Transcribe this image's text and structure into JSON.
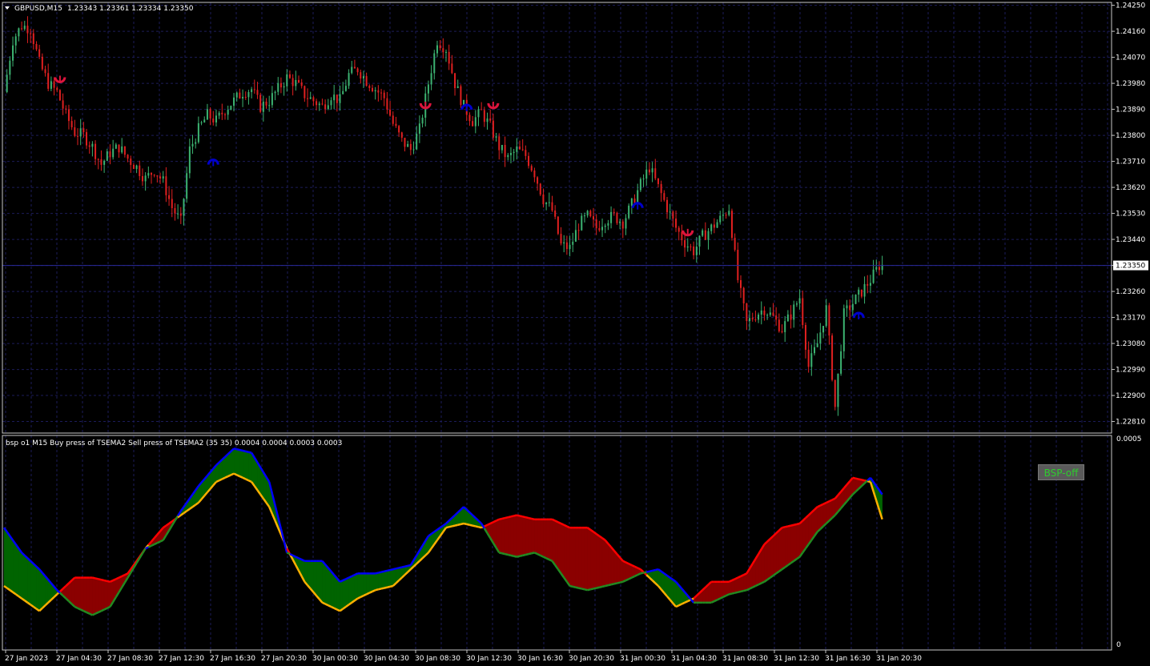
{
  "main_header": {
    "symbol_label": "GBPUSD,M15",
    "ohlc_label": "1.23343 1.23361 1.23334 1.23350"
  },
  "sub_header": {
    "text": "bsp o1 M15 Buy press of TSEMA2 Sell press of TSEMA2 (35 35) 0.0004 0.0004 0.0003 0.0003"
  },
  "bsp_button": {
    "label": "BSP-off"
  },
  "colors": {
    "background": "#000000",
    "grid": "#1c1c5a",
    "bull": "#3cb371",
    "bear": "#e02020",
    "buy_line": "#ffb000",
    "sell_line": "#ff0000",
    "blue_line": "#0000ff",
    "green_line": "#228b22",
    "fill_green": "#006400",
    "fill_red": "#8b0000",
    "up_arrow": "#0000cc",
    "down_arrow": "#dc143c",
    "current_price_line": "#2a2a9a"
  },
  "chart_data": [
    {
      "type": "candlestick",
      "symbol": "GBPUSD",
      "timeframe": "M15",
      "title": "GBPUSD,M15 1.23343 1.23361 1.23334 1.23350",
      "ylim": [
        1.2277,
        1.2426
      ],
      "y_ticks": [
        "1.24250",
        "1.24160",
        "1.24070",
        "1.23980",
        "1.23890",
        "1.23800",
        "1.23710",
        "1.23620",
        "1.23530",
        "1.23440",
        "1.23350",
        "1.23260",
        "1.23170",
        "1.23080",
        "1.22990",
        "1.22900",
        "1.22810"
      ],
      "current_price": "1.23350",
      "x_ticks": [
        "27 Jan 2023",
        "27 Jan 04:30",
        "27 Jan 08:30",
        "27 Jan 12:30",
        "27 Jan 16:30",
        "27 Jan 20:30",
        "30 Jan 00:30",
        "30 Jan 04:30",
        "30 Jan 08:30",
        "30 Jan 12:30",
        "30 Jan 16:30",
        "30 Jan 20:30",
        "31 Jan 00:30",
        "31 Jan 04:30",
        "31 Jan 08:30",
        "31 Jan 12:30",
        "31 Jan 16:30",
        "31 Jan 20:30"
      ],
      "close_path": [
        [
          0,
          1.2395
        ],
        [
          3,
          1.2413
        ],
        [
          6,
          1.2418
        ],
        [
          9,
          1.2417
        ],
        [
          12,
          1.2405
        ],
        [
          15,
          1.2398
        ],
        [
          18,
          1.2395
        ],
        [
          21,
          1.2387
        ],
        [
          24,
          1.2381
        ],
        [
          27,
          1.238
        ],
        [
          30,
          1.2376
        ],
        [
          33,
          1.237
        ],
        [
          36,
          1.2374
        ],
        [
          39,
          1.2376
        ],
        [
          42,
          1.2372
        ],
        [
          45,
          1.2369
        ],
        [
          48,
          1.2365
        ],
        [
          51,
          1.2368
        ],
        [
          54,
          1.2364
        ],
        [
          57,
          1.2355
        ],
        [
          60,
          1.235
        ],
        [
          63,
          1.2375
        ],
        [
          66,
          1.2382
        ],
        [
          69,
          1.2387
        ],
        [
          72,
          1.2385
        ],
        [
          75,
          1.2389
        ],
        [
          78,
          1.2392
        ],
        [
          81,
          1.2395
        ],
        [
          84,
          1.2396
        ],
        [
          87,
          1.239
        ],
        [
          90,
          1.2392
        ],
        [
          93,
          1.2396
        ],
        [
          96,
          1.24
        ],
        [
          99,
          1.2398
        ],
        [
          102,
          1.2394
        ],
        [
          105,
          1.2392
        ],
        [
          108,
          1.239
        ],
        [
          111,
          1.2394
        ],
        [
          114,
          1.2392
        ],
        [
          117,
          1.2401
        ],
        [
          120,
          1.2403
        ],
        [
          123,
          1.2399
        ],
        [
          126,
          1.2396
        ],
        [
          129,
          1.2393
        ],
        [
          132,
          1.2384
        ],
        [
          135,
          1.2378
        ],
        [
          138,
          1.2375
        ],
        [
          141,
          1.2382
        ],
        [
          144,
          1.2398
        ],
        [
          147,
          1.2413
        ],
        [
          150,
          1.241
        ],
        [
          153,
          1.2398
        ],
        [
          156,
          1.239
        ],
        [
          159,
          1.2385
        ],
        [
          162,
          1.2388
        ],
        [
          165,
          1.2383
        ],
        [
          168,
          1.2376
        ],
        [
          171,
          1.2372
        ],
        [
          174,
          1.2375
        ],
        [
          177,
          1.2373
        ],
        [
          180,
          1.2367
        ],
        [
          183,
          1.2358
        ],
        [
          186,
          1.2354
        ],
        [
          189,
          1.2342
        ],
        [
          192,
          1.2341
        ],
        [
          195,
          1.2349
        ],
        [
          198,
          1.2352
        ],
        [
          201,
          1.2348
        ],
        [
          204,
          1.2351
        ],
        [
          207,
          1.2352
        ],
        [
          210,
          1.235
        ],
        [
          213,
          1.2356
        ],
        [
          216,
          1.2363
        ],
        [
          219,
          1.2369
        ],
        [
          222,
          1.2362
        ],
        [
          225,
          1.2355
        ],
        [
          228,
          1.2348
        ],
        [
          231,
          1.2343
        ],
        [
          234,
          1.234
        ],
        [
          237,
          1.2345
        ],
        [
          240,
          1.2348
        ],
        [
          243,
          1.2351
        ],
        [
          246,
          1.2355
        ],
        [
          249,
          1.233
        ],
        [
          252,
          1.2315
        ],
        [
          255,
          1.2318
        ],
        [
          258,
          1.232
        ],
        [
          261,
          1.2317
        ],
        [
          264,
          1.2313
        ],
        [
          267,
          1.2318
        ],
        [
          270,
          1.2324
        ],
        [
          273,
          1.23
        ],
        [
          276,
          1.2308
        ],
        [
          279,
          1.232
        ],
        [
          282,
          1.2286
        ],
        [
          285,
          1.2318
        ],
        [
          288,
          1.2322
        ],
        [
          291,
          1.2326
        ],
        [
          294,
          1.233
        ],
        [
          297,
          1.2335
        ]
      ],
      "markers": [
        {
          "bar": 19,
          "price": 1.2399,
          "dir": "down"
        },
        {
          "bar": 71,
          "price": 1.2371,
          "dir": "up"
        },
        {
          "bar": 143,
          "price": 1.239,
          "dir": "down"
        },
        {
          "bar": 157,
          "price": 1.239,
          "dir": "up"
        },
        {
          "bar": 166,
          "price": 1.239,
          "dir": "down"
        },
        {
          "bar": 215,
          "price": 1.2356,
          "dir": "up"
        },
        {
          "bar": 232,
          "price": 1.2346,
          "dir": "down"
        },
        {
          "bar": 290,
          "price": 1.2318,
          "dir": "up"
        }
      ]
    },
    {
      "type": "area",
      "title": "bsp o1 M15 Buy press of TSEMA2 Sell press of TSEMA2 (35 35) 0.0004 0.0004 0.0003 0.0003",
      "ylim": [
        0,
        0.0005
      ],
      "y_ticks": [
        "0.0005",
        "0"
      ],
      "series": [
        {
          "name": "Buy press of TSEMA2",
          "values": [
            [
              0,
              0.00015
            ],
            [
              6,
              0.00012
            ],
            [
              12,
              9e-05
            ],
            [
              18,
              0.00013
            ],
            [
              24,
              0.00017
            ],
            [
              30,
              0.00017
            ],
            [
              36,
              0.00016
            ],
            [
              42,
              0.00018
            ],
            [
              48,
              0.00024
            ],
            [
              54,
              0.00029
            ],
            [
              60,
              0.00032
            ],
            [
              66,
              0.00035
            ],
            [
              72,
              0.0004
            ],
            [
              78,
              0.00042
            ],
            [
              84,
              0.0004
            ],
            [
              90,
              0.00034
            ],
            [
              96,
              0.00024
            ],
            [
              102,
              0.00016
            ],
            [
              108,
              0.00011
            ],
            [
              114,
              9e-05
            ],
            [
              120,
              0.00012
            ],
            [
              126,
              0.00014
            ],
            [
              132,
              0.00015
            ],
            [
              138,
              0.00019
            ],
            [
              144,
              0.00023
            ],
            [
              150,
              0.00029
            ],
            [
              156,
              0.0003
            ],
            [
              162,
              0.00029
            ],
            [
              168,
              0.00031
            ],
            [
              174,
              0.00032
            ],
            [
              180,
              0.00031
            ],
            [
              186,
              0.00031
            ],
            [
              192,
              0.00029
            ],
            [
              198,
              0.00029
            ],
            [
              204,
              0.00026
            ],
            [
              210,
              0.00021
            ],
            [
              216,
              0.00019
            ],
            [
              222,
              0.00015
            ],
            [
              228,
              0.0001
            ],
            [
              234,
              0.00012
            ],
            [
              240,
              0.00016
            ],
            [
              246,
              0.00016
            ],
            [
              252,
              0.00018
            ],
            [
              258,
              0.00025
            ],
            [
              264,
              0.00029
            ],
            [
              270,
              0.0003
            ],
            [
              276,
              0.00034
            ],
            [
              282,
              0.00036
            ],
            [
              288,
              0.00041
            ],
            [
              294,
              0.0004
            ],
            [
              298,
              0.00031
            ]
          ]
        },
        {
          "name": "Sell press of TSEMA2",
          "values": [
            [
              0,
              0.00029
            ],
            [
              6,
              0.00023
            ],
            [
              12,
              0.00019
            ],
            [
              18,
              0.00014
            ],
            [
              24,
              0.0001
            ],
            [
              30,
              8e-05
            ],
            [
              36,
              0.0001
            ],
            [
              42,
              0.00017
            ],
            [
              48,
              0.00024
            ],
            [
              54,
              0.00026
            ],
            [
              60,
              0.00033
            ],
            [
              66,
              0.00039
            ],
            [
              72,
              0.00044
            ],
            [
              78,
              0.00048
            ],
            [
              84,
              0.00047
            ],
            [
              90,
              0.0004
            ],
            [
              96,
              0.00023
            ],
            [
              102,
              0.00021
            ],
            [
              108,
              0.00021
            ],
            [
              114,
              0.00016
            ],
            [
              120,
              0.00018
            ],
            [
              126,
              0.00018
            ],
            [
              132,
              0.00019
            ],
            [
              138,
              0.0002
            ],
            [
              144,
              0.00027
            ],
            [
              150,
              0.0003
            ],
            [
              156,
              0.00034
            ],
            [
              162,
              0.0003
            ],
            [
              168,
              0.00023
            ],
            [
              174,
              0.00022
            ],
            [
              180,
              0.00023
            ],
            [
              186,
              0.00021
            ],
            [
              192,
              0.00015
            ],
            [
              198,
              0.00014
            ],
            [
              204,
              0.00015
            ],
            [
              210,
              0.00016
            ],
            [
              216,
              0.00018
            ],
            [
              222,
              0.00019
            ],
            [
              228,
              0.00016
            ],
            [
              234,
              0.00011
            ],
            [
              240,
              0.00011
            ],
            [
              246,
              0.00013
            ],
            [
              252,
              0.00014
            ],
            [
              258,
              0.00016
            ],
            [
              264,
              0.00019
            ],
            [
              270,
              0.00022
            ],
            [
              276,
              0.00028
            ],
            [
              282,
              0.00032
            ],
            [
              288,
              0.00037
            ],
            [
              294,
              0.00041
            ],
            [
              298,
              0.00037
            ]
          ]
        }
      ]
    }
  ]
}
